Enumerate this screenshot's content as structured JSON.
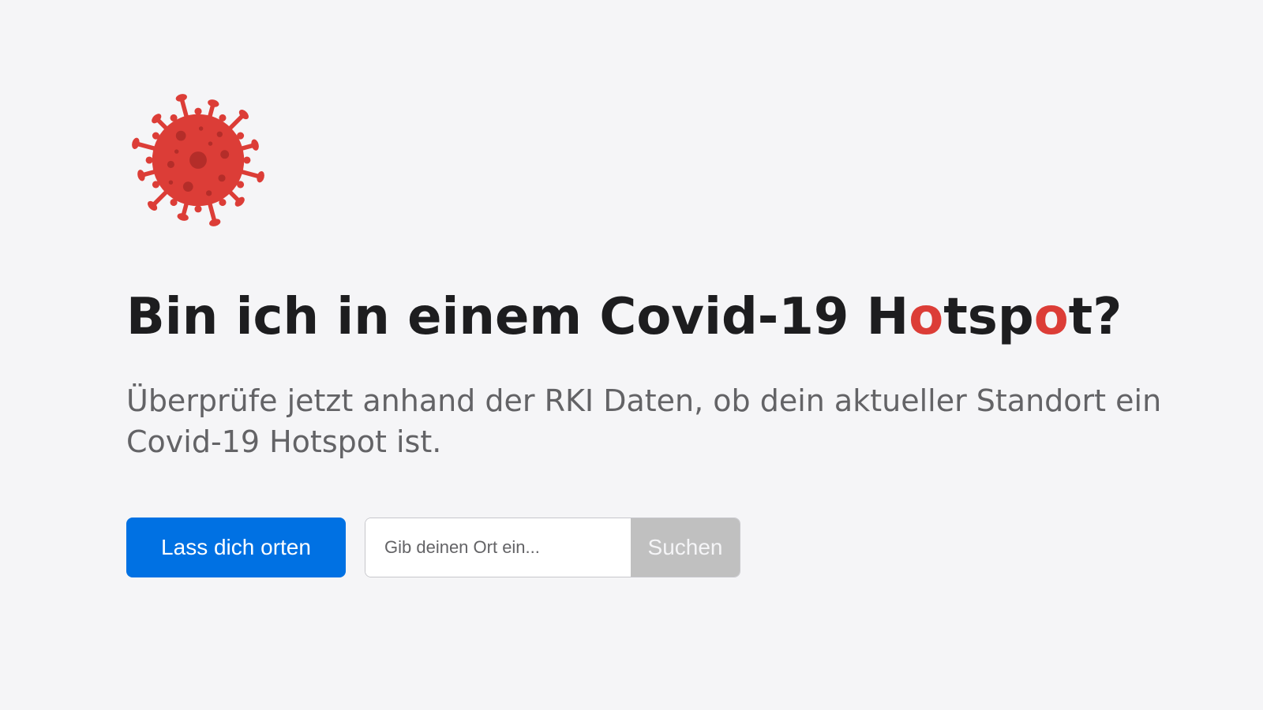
{
  "logo": {
    "icon": "coronavirus-icon",
    "color": "#dc3d37",
    "dark_color": "#b42d29"
  },
  "heading": {
    "parts": [
      "Bin ich in einem Covid-19 H",
      "o",
      "tsp",
      "o",
      "t?"
    ],
    "accent_color": "#dc3d37"
  },
  "subtitle": "Überprüfe jetzt anhand der RKI Daten, ob dein aktueller Standort ein Covid-19 Hotspot ist.",
  "actions": {
    "locate_label": "Lass dich orten",
    "search_placeholder": "Gib deinen Ort ein...",
    "search_value": "",
    "search_label": "Suchen",
    "primary_color": "#0071e3",
    "disabled_color": "#c0c0c0"
  }
}
